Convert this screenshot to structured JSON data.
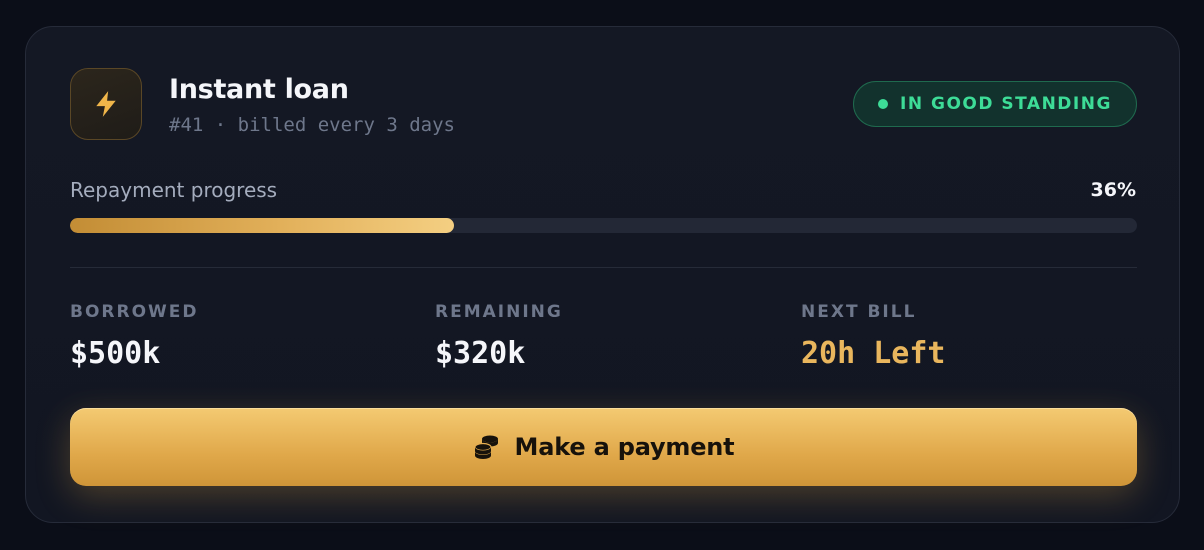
{
  "loan": {
    "icon": "lightning-bolt-icon",
    "title": "Instant loan",
    "subtitle": "#41 · billed every 3 days"
  },
  "status": {
    "label": "IN GOOD STANDING",
    "color": "#3ddc97"
  },
  "progress": {
    "label": "Repayment progress",
    "value_text": "36%",
    "fraction": 0.36
  },
  "stats": [
    {
      "label": "BORROWED",
      "value": "$500k"
    },
    {
      "label": "REMAINING",
      "value": "$320k"
    },
    {
      "label": "NEXT BILL",
      "value": "20h Left"
    }
  ],
  "action": {
    "label": "Make a payment",
    "icon": "coins-icon"
  },
  "colors": {
    "accent": "#e9b65d",
    "background": "#0b0e18",
    "card": "#141824"
  }
}
